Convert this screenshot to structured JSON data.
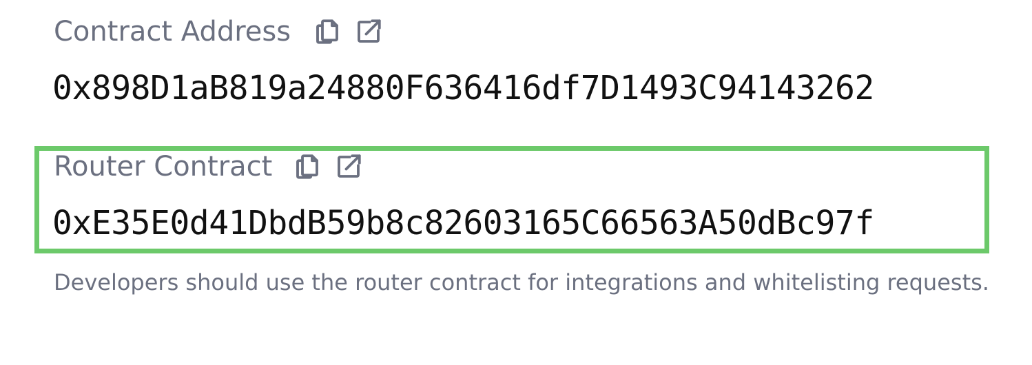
{
  "contract": {
    "label": "Contract Address",
    "address": "0x898D1aB819a24880F636416df7D1493C94143262",
    "copy_icon": "copy-icon",
    "external_icon": "external-link-icon"
  },
  "router": {
    "label": "Router Contract",
    "address": "0xE35E0d41DbdB59b8c82603165C66563A50dBc97f",
    "copy_icon": "copy-icon",
    "external_icon": "external-link-icon",
    "highlight_color": "#6cc96a"
  },
  "note": "Developers should use the router contract for integrations and whitelisting requests.",
  "colors": {
    "label": "#6b7080",
    "address": "#111111",
    "background": "#ffffff"
  }
}
